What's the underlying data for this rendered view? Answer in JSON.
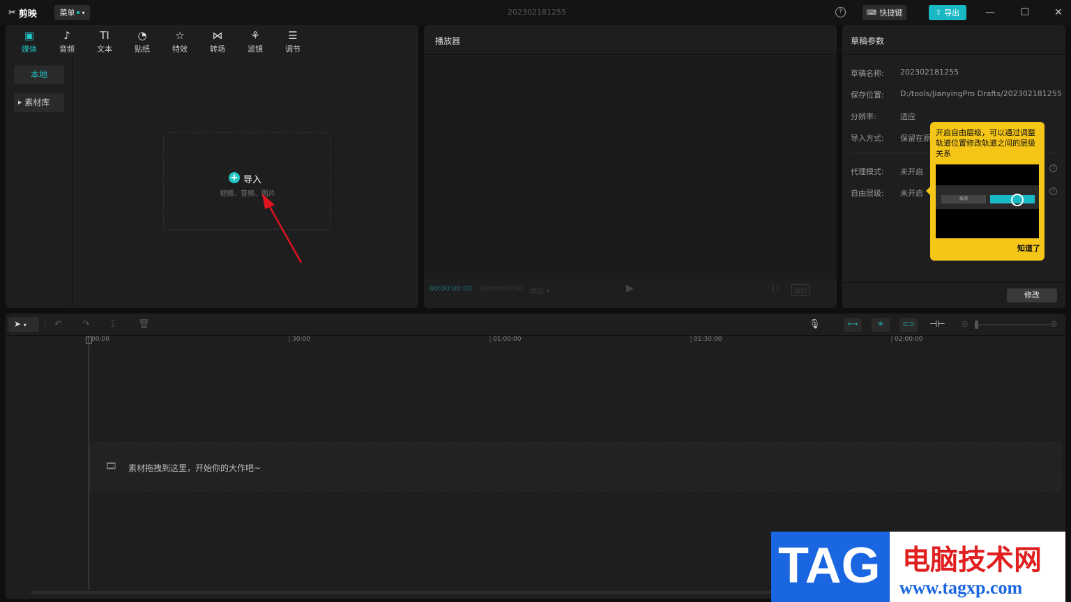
{
  "app": {
    "logo": "剪映",
    "menu_label": "菜单",
    "doc_title": "202302181255",
    "shortcut_label": "快捷键",
    "export_label": "导出",
    "accent": "#22c4c4"
  },
  "media_tabs": [
    {
      "label": "媒体",
      "icon": "media-icon"
    },
    {
      "label": "音频",
      "icon": "audio-icon"
    },
    {
      "label": "文本",
      "icon": "text-icon"
    },
    {
      "label": "贴纸",
      "icon": "sticker-icon"
    },
    {
      "label": "特效",
      "icon": "effects-icon"
    },
    {
      "label": "转场",
      "icon": "transition-icon"
    },
    {
      "label": "滤镜",
      "icon": "filter-icon"
    },
    {
      "label": "调节",
      "icon": "adjust-icon"
    }
  ],
  "media_sidebar": {
    "local": "本地",
    "library": "素材库"
  },
  "import": {
    "label": "导入",
    "sub": "视频、音频、图片"
  },
  "player": {
    "title": "播放器",
    "time_current": "00:00:00:00",
    "time_total": "00:00:00:00",
    "quality": "适应",
    "ratio": "适应"
  },
  "draft": {
    "title": "草稿参数",
    "rows": [
      {
        "label": "草稿名称:",
        "value": "202302181255"
      },
      {
        "label": "保存位置:",
        "value": "D:/tools/JianyingPro Drafts/202302181255"
      },
      {
        "label": "分辨率:",
        "value": "适应"
      },
      {
        "label": "导入方式:",
        "value": "保留在原"
      },
      {
        "label": "代理模式:",
        "value": "未开启"
      },
      {
        "label": "自由层级:",
        "value": "未开启"
      }
    ],
    "modify_label": "修改"
  },
  "tooltip": {
    "text": "开启自由层级，可以通过调整轨道位置修改轨道之间的层级关系",
    "ok": "知道了",
    "demo_cancel": "取消"
  },
  "timeline": {
    "ruler": [
      "00:00",
      "30:00",
      "01:00:00",
      "01:30:00",
      "02:00:00"
    ],
    "drop_hint": "素材拖拽到这里，开始你的大作吧~"
  },
  "watermark": {
    "tag": "TAG",
    "site_name": "电脑技术网",
    "url": "www.tagxp.com"
  }
}
